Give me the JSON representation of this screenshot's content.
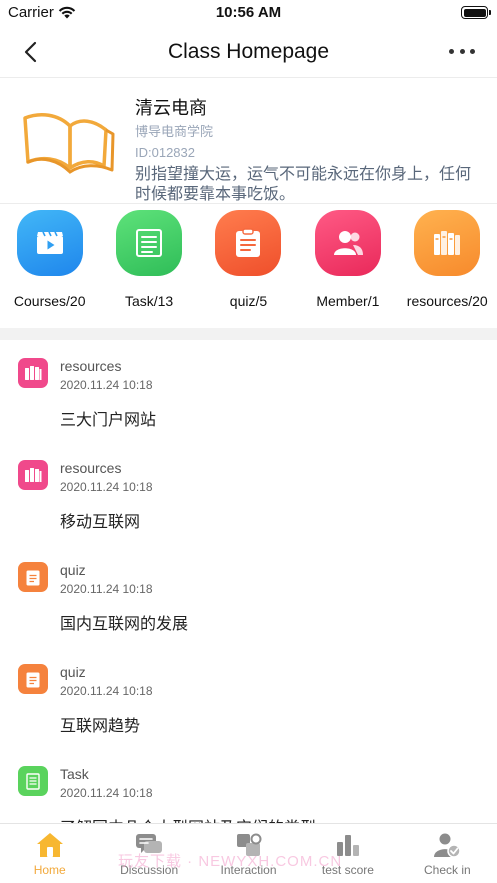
{
  "status_bar": {
    "carrier": "Carrier",
    "time": "10:56 AM"
  },
  "nav": {
    "title": "Class Homepage"
  },
  "class_info": {
    "name": "清云电商",
    "school": "博导电商学院",
    "id": "ID:012832",
    "motto": "别指望撞大运，运气不可能永远在你身上，任何时候都要靠本事吃饭。"
  },
  "features": [
    {
      "label": "Courses/20",
      "icon": "video-icon",
      "color": "#2f9ff2"
    },
    {
      "label": "Task/13",
      "icon": "task-list-icon",
      "color": "#43cd6a"
    },
    {
      "label": "quiz/5",
      "icon": "quiz-icon",
      "color": "#f5683d"
    },
    {
      "label": "Member/1",
      "icon": "member-icon",
      "color": "#f03d6b"
    },
    {
      "label": "resources/20",
      "icon": "books-icon",
      "color": "#f99a3a"
    }
  ],
  "activities": [
    {
      "type": "resources",
      "time": "2020.11.24 10:18",
      "title": "三大门户网站",
      "icon": "books-icon",
      "color": "#f0498b"
    },
    {
      "type": "resources",
      "time": "2020.11.24 10:18",
      "title": "移动互联网",
      "icon": "books-icon",
      "color": "#f0498b"
    },
    {
      "type": "quiz",
      "time": "2020.11.24 10:18",
      "title": "国内互联网的发展",
      "icon": "quiz-icon",
      "color": "#f5823d"
    },
    {
      "type": "quiz",
      "time": "2020.11.24 10:18",
      "title": "互联网趋势",
      "icon": "quiz-icon",
      "color": "#f5823d"
    },
    {
      "type": "Task",
      "time": "2020.11.24 10:18",
      "title": "了解国内几个大型网站及它们的类型",
      "icon": "task-list-icon",
      "color": "#5ad35d"
    }
  ],
  "tabs": [
    {
      "label": "Home",
      "icon": "home-icon",
      "active": true
    },
    {
      "label": "Discussion",
      "icon": "discussion-icon",
      "active": false
    },
    {
      "label": "Interaction",
      "icon": "interaction-icon",
      "active": false
    },
    {
      "label": "test score",
      "icon": "bar-chart-icon",
      "active": false
    },
    {
      "label": "Check in",
      "icon": "check-in-icon",
      "active": false
    }
  ],
  "watermark": "玩友下载 · NEWYXH.COM.CN",
  "colors": {
    "accent": "#f2a93b",
    "tab_inactive": "#777777",
    "divider": "#f2f2f2"
  }
}
